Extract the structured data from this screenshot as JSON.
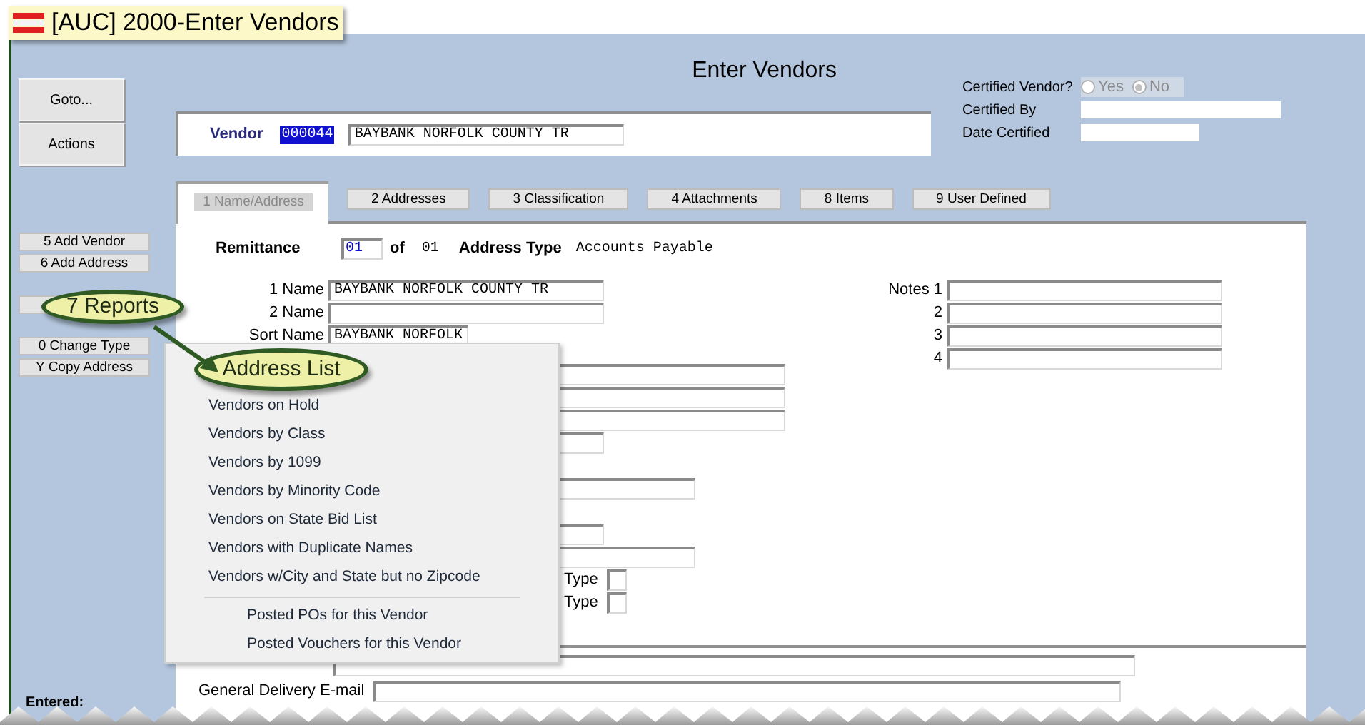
{
  "window": {
    "title": "[AUC] 2000-Enter Vendors"
  },
  "heading": "Enter Vendors",
  "side_buttons": [
    {
      "label": "Goto..."
    },
    {
      "label": "Actions"
    }
  ],
  "action_groups": [
    [
      {
        "label": "5 Add Vendor",
        "kind": "plain"
      },
      {
        "label": "6 Add Address",
        "kind": "plain"
      }
    ],
    [
      {
        "label": "7 Reports",
        "kind": "callout"
      }
    ],
    [
      {
        "label": "0 Change Type",
        "kind": "plain"
      },
      {
        "label": "Y Copy Address",
        "kind": "plain"
      }
    ]
  ],
  "vendor": {
    "label": "Vendor",
    "number": "000044",
    "name": "BAYBANK NORFOLK COUNTY TR"
  },
  "certified": {
    "label": "Certified Vendor?",
    "options": [
      {
        "label": "Yes",
        "selected": false
      },
      {
        "label": "No",
        "selected": true
      }
    ],
    "certified_by_label": "Certified By",
    "date_label": "Date Certified"
  },
  "tabs": [
    {
      "label": "1 Name/Address",
      "selected": true
    },
    {
      "label": "2 Addresses",
      "selected": false
    },
    {
      "label": "3 Classification",
      "selected": false
    },
    {
      "label": "4 Attachments",
      "selected": false
    },
    {
      "label": "8 Items",
      "selected": false
    },
    {
      "label": "9 User Defined",
      "selected": false
    }
  ],
  "remittance": {
    "label": "Remittance",
    "value": "01",
    "of_label": "of",
    "total": "01",
    "type_label": "Address Type",
    "type": "Accounts Payable"
  },
  "names": [
    {
      "label": "1 Name",
      "value": "BAYBANK NORFOLK COUNTY TR"
    },
    {
      "label": "2 Name"
    },
    {
      "label": "Sort Name",
      "value": "BAYBANK NORFOLK"
    }
  ],
  "notes": [
    {
      "label": "Notes 1"
    },
    {
      "label": "2"
    },
    {
      "label": "3"
    },
    {
      "label": "4"
    }
  ],
  "type_labels": [
    "Type",
    "Type"
  ],
  "email_label": "General Delivery E-mail",
  "entered_label": "Entered:",
  "menu": {
    "groups": [
      [
        {
          "label": "Address List",
          "highlighted": true
        },
        {
          "label": "Vendors on Hold",
          "highlighted": false
        },
        {
          "label": "Vendors by Class",
          "highlighted": false
        },
        {
          "label": "Vendors by 1099",
          "highlighted": false
        },
        {
          "label": "Vendors by Minority Code",
          "highlighted": false
        },
        {
          "label": "Vendors on State Bid List",
          "highlighted": false
        },
        {
          "label": "Vendors with Duplicate Names",
          "highlighted": false
        },
        {
          "label": "Vendors w/City and State but no Zipcode",
          "highlighted": false
        }
      ],
      [
        {
          "label": "Posted POs for this Vendor",
          "highlighted": false
        },
        {
          "label": "Posted Vouchers for this Vendor",
          "highlighted": false
        }
      ]
    ]
  }
}
